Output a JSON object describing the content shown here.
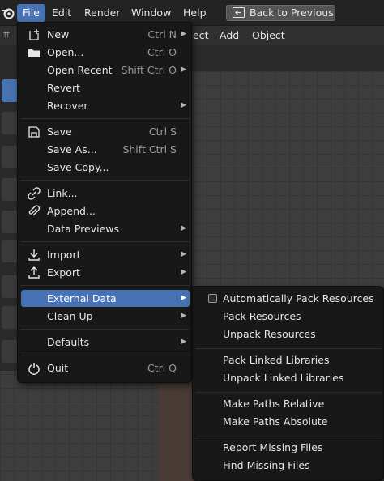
{
  "topbar": {
    "menus": [
      "File",
      "Edit",
      "Render",
      "Window",
      "Help"
    ],
    "active_menu": "File",
    "back_button": "Back to Previous"
  },
  "header": {
    "items": [
      "ect",
      "Add",
      "Object"
    ]
  },
  "file_menu": {
    "items": [
      {
        "label": "New",
        "shortcut": "Ctrl N",
        "submenu": true,
        "icon": "new-file-icon"
      },
      {
        "label": "Open...",
        "shortcut": "Ctrl O",
        "icon": "folder-icon"
      },
      {
        "label": "Open Recent",
        "shortcut": "Shift Ctrl O",
        "submenu": true
      },
      {
        "label": "Revert"
      },
      {
        "label": "Recover",
        "submenu": true
      },
      {
        "label": "Save",
        "shortcut": "Ctrl S",
        "icon": "save-icon"
      },
      {
        "label": "Save As...",
        "shortcut": "Shift Ctrl S"
      },
      {
        "label": "Save Copy..."
      },
      {
        "label": "Link...",
        "icon": "link-icon"
      },
      {
        "label": "Append...",
        "icon": "append-icon"
      },
      {
        "label": "Data Previews",
        "submenu": true
      },
      {
        "label": "Import",
        "submenu": true,
        "icon": "import-icon"
      },
      {
        "label": "Export",
        "submenu": true,
        "icon": "export-icon"
      },
      {
        "label": "External Data",
        "submenu": true,
        "highlighted": true
      },
      {
        "label": "Clean Up",
        "submenu": true
      },
      {
        "label": "Defaults",
        "submenu": true
      },
      {
        "label": "Quit",
        "shortcut": "Ctrl Q",
        "icon": "power-icon"
      }
    ]
  },
  "external_data_submenu": {
    "items": [
      {
        "label": "Automatically Pack Resources",
        "checkbox": true,
        "checked": false
      },
      {
        "label": "Pack Resources"
      },
      {
        "label": "Unpack Resources"
      },
      {
        "label": "Pack Linked Libraries"
      },
      {
        "label": "Unpack Linked Libraries"
      },
      {
        "label": "Make Paths Relative"
      },
      {
        "label": "Make Paths Absolute"
      },
      {
        "label": "Report Missing Files"
      },
      {
        "label": "Find Missing Files"
      }
    ]
  },
  "colors": {
    "accent": "#4772b3",
    "menu_bg": "#181818",
    "shortcut_text": "#9a9a9a"
  }
}
